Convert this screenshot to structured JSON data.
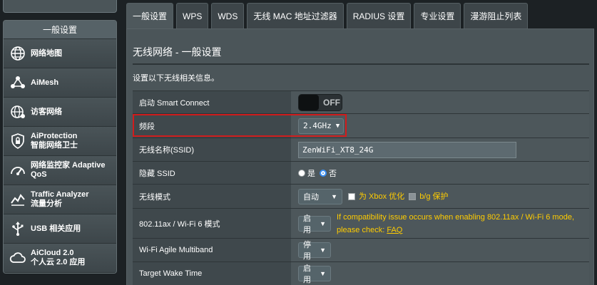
{
  "sidebar": {
    "header": "一般设置",
    "items": [
      {
        "label_lines": [
          "网络地图"
        ],
        "icon": "globe-network-icon"
      },
      {
        "label_lines": [
          "AiMesh"
        ],
        "icon": "mesh-nodes-icon"
      },
      {
        "label_lines": [
          "访客网络"
        ],
        "icon": "guest-globe-icon"
      },
      {
        "label_lines": [
          "AiProtection",
          "智能网络卫士"
        ],
        "icon": "shield-lock-icon"
      },
      {
        "label_lines": [
          "网络监控家 Adaptive",
          "QoS"
        ],
        "icon": "speed-gauge-icon"
      },
      {
        "label_lines": [
          "Traffic Analyzer",
          "流量分析"
        ],
        "icon": "traffic-chart-icon"
      },
      {
        "label_lines": [
          "USB 相关应用"
        ],
        "icon": "usb-plug-icon"
      },
      {
        "label_lines": [
          "AiCloud 2.0",
          "个人云 2.0 应用"
        ],
        "icon": "cloud-icon"
      }
    ]
  },
  "tabs": [
    {
      "label": "一般设置",
      "active": true
    },
    {
      "label": "WPS"
    },
    {
      "label": "WDS"
    },
    {
      "label": "无线 MAC 地址过滤器"
    },
    {
      "label": "RADIUS 设置"
    },
    {
      "label": "专业设置"
    },
    {
      "label": "漫游阻止列表"
    }
  ],
  "main": {
    "title": "无线网络 - 一般设置",
    "description": "设置以下无线相关信息。"
  },
  "settings": {
    "smart_connect": {
      "label": "启动 Smart Connect",
      "toggle_text": "OFF"
    },
    "band": {
      "label": "频段",
      "value": "2.4GHz"
    },
    "ssid": {
      "label": "无线名称(SSID)",
      "value": "ZenWiFi_XT8_24G"
    },
    "hide_ssid": {
      "label": "隐藏 SSID",
      "yes": "是",
      "no": "否",
      "selected": "no"
    },
    "wireless_mode": {
      "label": "无线模式",
      "value": "自动",
      "xbox_label": "为 Xbox 优化",
      "bg_label": "b/g 保护"
    },
    "ax_mode": {
      "label": "802.11ax / Wi-Fi 6 模式",
      "value": "启用",
      "warning": "If compatibility issue occurs when enabling 802.11ax / Wi-Fi 6 mode,",
      "warning2": "please check:",
      "faq": "FAQ"
    },
    "agile_multiband": {
      "label": "Wi-Fi Agile Multiband",
      "value": "停用"
    },
    "twt": {
      "label": "Target Wake Time",
      "value": "启用"
    }
  },
  "colors": {
    "highlight": "#d01c1c",
    "warning": "#ffcc00",
    "radio_accent": "#3b8ef0"
  }
}
